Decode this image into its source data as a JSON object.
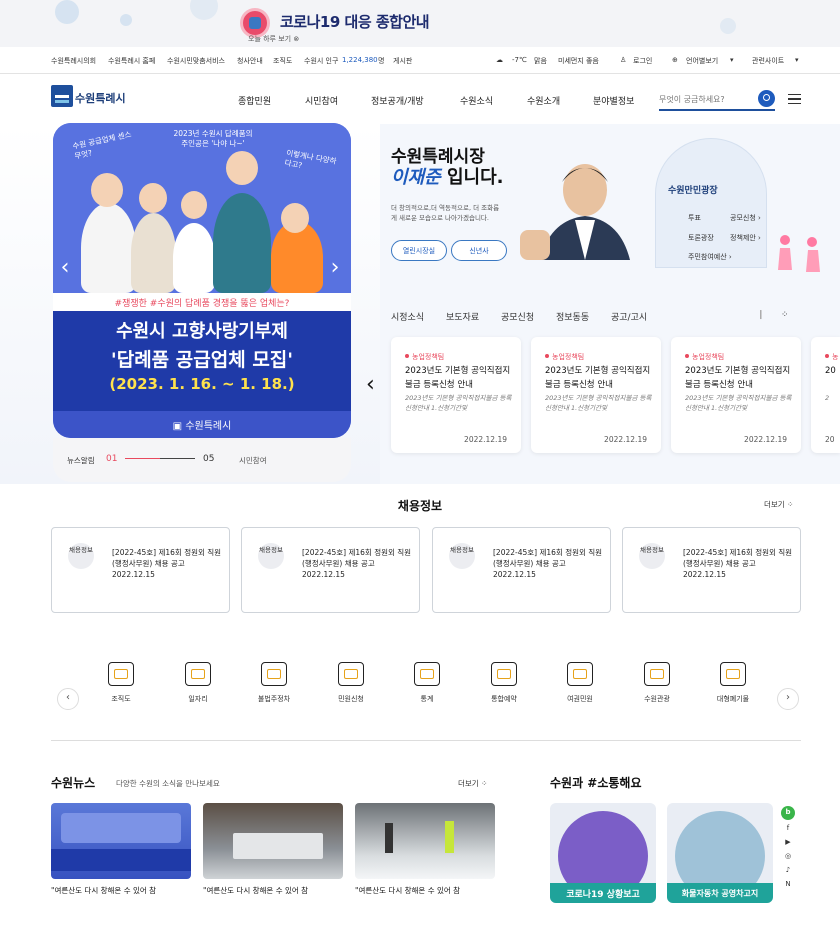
{
  "covid": {
    "title_prefix": "코로나19",
    "title_suffix": "대응 종합안내",
    "sub": "오늘 하루 보기"
  },
  "util": {
    "links": [
      "수원특례시의회",
      "수원특례시 홈페",
      "수원시민맞춤서비스",
      "청사안내",
      "조직도"
    ],
    "population_label": "수원시 인구",
    "population_value": "1,224,380",
    "population_unit": "명",
    "board": "게시판",
    "weather": "-7℃",
    "weather_desc": "맑음",
    "dust": "미세먼지 좋음",
    "login": "로그인",
    "language": "언어별보기",
    "related": "관련사이트"
  },
  "gnb": {
    "logo": "수원특례시",
    "menu": [
      "종합민원",
      "시민참여",
      "정보공개/개방",
      "수원소식",
      "수원소개",
      "분야별정보"
    ],
    "search_placeholder": "무엇이 궁금하세요?"
  },
  "banner": {
    "bubble1": "수원 공급업체 센스 무엇?",
    "bubble2": "2023년 수원시 답례품의 주인공은 '나야 나~'",
    "bubble3": "이렇게나 다양하다고?",
    "hashline": "#쟁쟁한  #수원의 답례품 경쟁을 뚫은 업체는?",
    "line1": "수원시 고향사랑기부제",
    "line2": "'답례품 공급업체 모집'",
    "line3": "(2023. 1. 16. ~ 1. 18.)",
    "footer": "수원특례시",
    "news_label": "뉴스알림",
    "current": "01",
    "total": "05",
    "citizen": "시민참여"
  },
  "mayor": {
    "title": "수원특례시장",
    "name": "이재준",
    "suffix": "입니다.",
    "desc": "더 창의적으로,더 역동적으로, 더 조화롭게 새로운 모습으로 나아가겠습니다.",
    "btn1": "열린시장실",
    "btn2": "신년사"
  },
  "plaza": {
    "title": "수원만민광장",
    "items": [
      "투표",
      "공모신청",
      "토론광장",
      "정책제안",
      "주민참여예산"
    ]
  },
  "tabs": [
    "시정소식",
    "보도자료",
    "공모신청",
    "정보동동",
    "공고/고시"
  ],
  "cards": [
    {
      "cat": "농업정책팀",
      "title": "2023년도 기본형 공익직접지불금 등록신청 안내",
      "desc": "2023년도 기본형 공익직접지불금 등록신청안내 1.신청기간및",
      "date": "2022.12.19"
    },
    {
      "cat": "농업정책팀",
      "title": "2023년도 기본형 공익직접지불금 등록신청 안내",
      "desc": "2023년도 기본형 공익직접지불금 등록신청안내 1.신청기간및",
      "date": "2022.12.19"
    },
    {
      "cat": "농업정책팀",
      "title": "2023년도 기본형 공익직접지불금 등록신청 안내",
      "desc": "2023년도 기본형 공익직접지불금 등록신청안내 1.신청기간및",
      "date": "2022.12.19"
    },
    {
      "cat": "농",
      "title": "20",
      "desc": "2",
      "date": "20"
    }
  ],
  "jobs": {
    "title": "채용정보",
    "more": "더보기",
    "badge": "채용정보",
    "items": [
      {
        "text": "[2022-45호] 제16회 정원외 직원(행정사무원) 채용 공고",
        "date": "2022.12.15"
      },
      {
        "text": "[2022-45호] 제16회 정원외 직원(행정사무원) 채용 공고",
        "date": "2022.12.15"
      },
      {
        "text": "[2022-45호] 제16회 정원외 직원(행정사무원) 채용 공고",
        "date": "2022.12.15"
      },
      {
        "text": "[2022-45호] 제16회 정원외 직원(행정사무원) 채용 공고",
        "date": "2022.12.15"
      }
    ]
  },
  "services": [
    "조직도",
    "일자리",
    "불법주정차",
    "민원신청",
    "통계",
    "통합예약",
    "여권민원",
    "수원관광",
    "대형폐기물"
  ],
  "news": {
    "title": "수원뉴스",
    "sub": "다양한 수원의 소식을 만나보세요",
    "more": "더보기",
    "captions": [
      "\"여른산도 다시 창해온 수 있어 참",
      "\"여른산도 다시 창해온 수 있어 참",
      "\"여른산도 다시 창해온 수 있어 참"
    ]
  },
  "sns": {
    "title": "수원과 #소통해요",
    "t1": "코로나19 상황보고",
    "t2": "화물자동차 공영차고지"
  }
}
